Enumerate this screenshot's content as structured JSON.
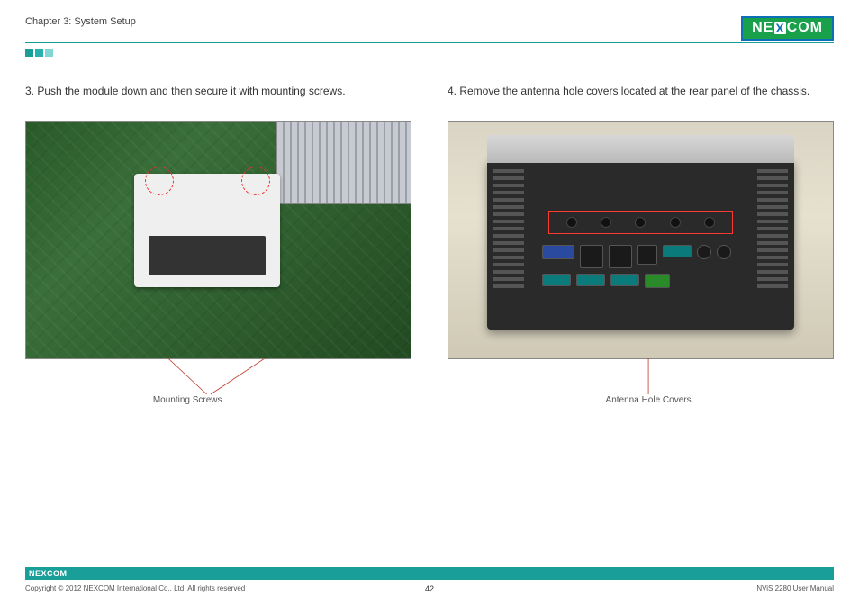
{
  "header": {
    "chapter": "Chapter 3: System Setup",
    "brand": "NEXCOM"
  },
  "left": {
    "step": "3. Push the module down and then secure it with mounting screws.",
    "caption": "Mounting Screws"
  },
  "right": {
    "step": "4. Remove the antenna hole covers located at the rear panel of the chassis.",
    "caption": "Antenna Hole Covers"
  },
  "footer": {
    "brand": "NEXCOM",
    "copyright": "Copyright © 2012 NEXCOM International Co., Ltd. All rights reserved",
    "page": "42",
    "manual": "NViS 2280 User Manual"
  }
}
